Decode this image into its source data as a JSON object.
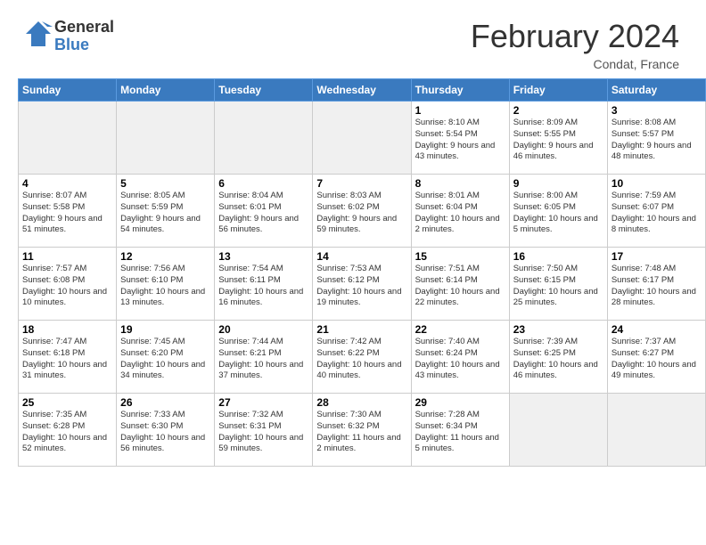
{
  "logo": {
    "general": "General",
    "blue": "Blue"
  },
  "header": {
    "month": "February 2024",
    "location": "Condat, France"
  },
  "days_of_week": [
    "Sunday",
    "Monday",
    "Tuesday",
    "Wednesday",
    "Thursday",
    "Friday",
    "Saturday"
  ],
  "weeks": [
    [
      {
        "day": "",
        "empty": true
      },
      {
        "day": "",
        "empty": true
      },
      {
        "day": "",
        "empty": true
      },
      {
        "day": "",
        "empty": true
      },
      {
        "day": "1",
        "sunrise": "8:10 AM",
        "sunset": "5:54 PM",
        "daylight": "9 hours and 43 minutes."
      },
      {
        "day": "2",
        "sunrise": "8:09 AM",
        "sunset": "5:55 PM",
        "daylight": "9 hours and 46 minutes."
      },
      {
        "day": "3",
        "sunrise": "8:08 AM",
        "sunset": "5:57 PM",
        "daylight": "9 hours and 48 minutes."
      }
    ],
    [
      {
        "day": "4",
        "sunrise": "8:07 AM",
        "sunset": "5:58 PM",
        "daylight": "9 hours and 51 minutes."
      },
      {
        "day": "5",
        "sunrise": "8:05 AM",
        "sunset": "5:59 PM",
        "daylight": "9 hours and 54 minutes."
      },
      {
        "day": "6",
        "sunrise": "8:04 AM",
        "sunset": "6:01 PM",
        "daylight": "9 hours and 56 minutes."
      },
      {
        "day": "7",
        "sunrise": "8:03 AM",
        "sunset": "6:02 PM",
        "daylight": "9 hours and 59 minutes."
      },
      {
        "day": "8",
        "sunrise": "8:01 AM",
        "sunset": "6:04 PM",
        "daylight": "10 hours and 2 minutes."
      },
      {
        "day": "9",
        "sunrise": "8:00 AM",
        "sunset": "6:05 PM",
        "daylight": "10 hours and 5 minutes."
      },
      {
        "day": "10",
        "sunrise": "7:59 AM",
        "sunset": "6:07 PM",
        "daylight": "10 hours and 8 minutes."
      }
    ],
    [
      {
        "day": "11",
        "sunrise": "7:57 AM",
        "sunset": "6:08 PM",
        "daylight": "10 hours and 10 minutes."
      },
      {
        "day": "12",
        "sunrise": "7:56 AM",
        "sunset": "6:10 PM",
        "daylight": "10 hours and 13 minutes."
      },
      {
        "day": "13",
        "sunrise": "7:54 AM",
        "sunset": "6:11 PM",
        "daylight": "10 hours and 16 minutes."
      },
      {
        "day": "14",
        "sunrise": "7:53 AM",
        "sunset": "6:12 PM",
        "daylight": "10 hours and 19 minutes."
      },
      {
        "day": "15",
        "sunrise": "7:51 AM",
        "sunset": "6:14 PM",
        "daylight": "10 hours and 22 minutes."
      },
      {
        "day": "16",
        "sunrise": "7:50 AM",
        "sunset": "6:15 PM",
        "daylight": "10 hours and 25 minutes."
      },
      {
        "day": "17",
        "sunrise": "7:48 AM",
        "sunset": "6:17 PM",
        "daylight": "10 hours and 28 minutes."
      }
    ],
    [
      {
        "day": "18",
        "sunrise": "7:47 AM",
        "sunset": "6:18 PM",
        "daylight": "10 hours and 31 minutes."
      },
      {
        "day": "19",
        "sunrise": "7:45 AM",
        "sunset": "6:20 PM",
        "daylight": "10 hours and 34 minutes."
      },
      {
        "day": "20",
        "sunrise": "7:44 AM",
        "sunset": "6:21 PM",
        "daylight": "10 hours and 37 minutes."
      },
      {
        "day": "21",
        "sunrise": "7:42 AM",
        "sunset": "6:22 PM",
        "daylight": "10 hours and 40 minutes."
      },
      {
        "day": "22",
        "sunrise": "7:40 AM",
        "sunset": "6:24 PM",
        "daylight": "10 hours and 43 minutes."
      },
      {
        "day": "23",
        "sunrise": "7:39 AM",
        "sunset": "6:25 PM",
        "daylight": "10 hours and 46 minutes."
      },
      {
        "day": "24",
        "sunrise": "7:37 AM",
        "sunset": "6:27 PM",
        "daylight": "10 hours and 49 minutes."
      }
    ],
    [
      {
        "day": "25",
        "sunrise": "7:35 AM",
        "sunset": "6:28 PM",
        "daylight": "10 hours and 52 minutes."
      },
      {
        "day": "26",
        "sunrise": "7:33 AM",
        "sunset": "6:30 PM",
        "daylight": "10 hours and 56 minutes."
      },
      {
        "day": "27",
        "sunrise": "7:32 AM",
        "sunset": "6:31 PM",
        "daylight": "10 hours and 59 minutes."
      },
      {
        "day": "28",
        "sunrise": "7:30 AM",
        "sunset": "6:32 PM",
        "daylight": "11 hours and 2 minutes."
      },
      {
        "day": "29",
        "sunrise": "7:28 AM",
        "sunset": "6:34 PM",
        "daylight": "11 hours and 5 minutes."
      },
      {
        "day": "",
        "empty": true
      },
      {
        "day": "",
        "empty": true
      }
    ]
  ]
}
